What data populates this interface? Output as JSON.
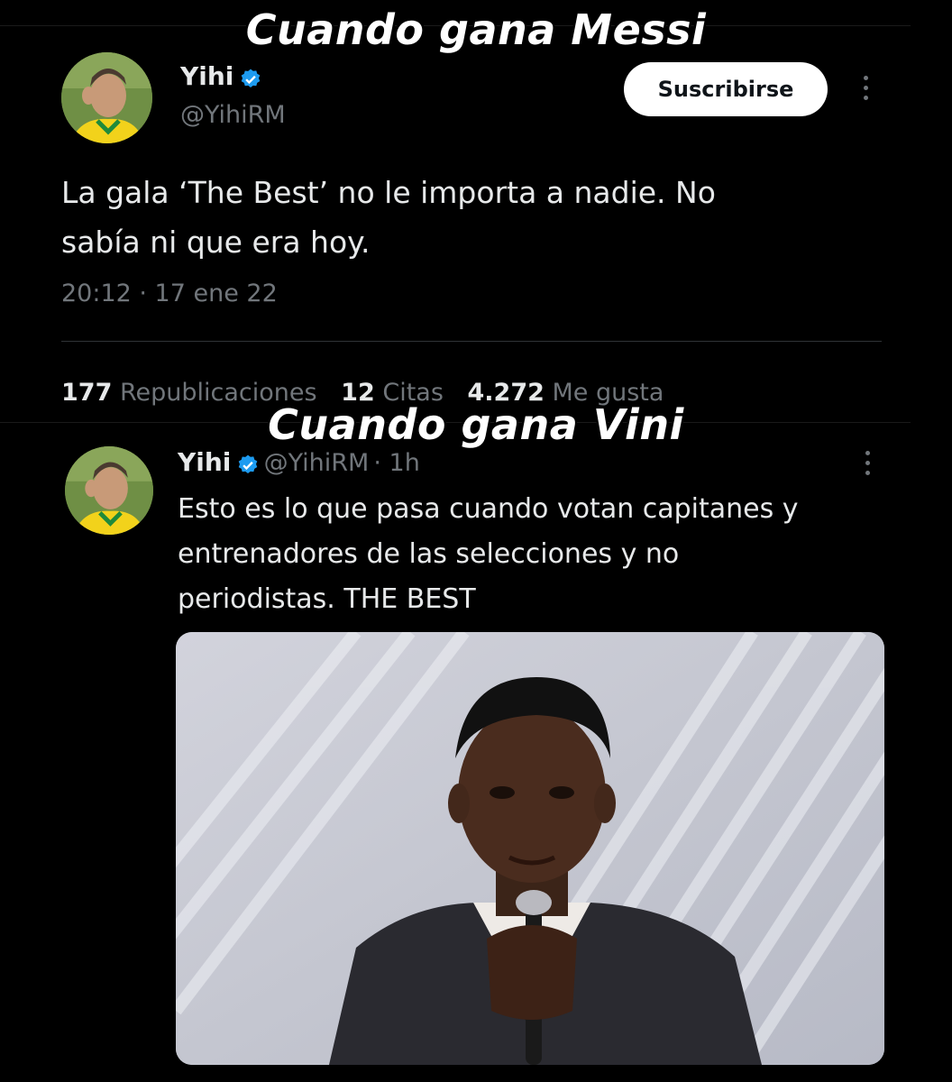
{
  "captions": {
    "top": "Cuando gana Messi",
    "middle": "Cuando gana Vini"
  },
  "tweet1": {
    "author_name": "Yihi",
    "author_handle": "@YihiRM",
    "subscribe_label": "Suscribirse",
    "text_line1": "La gala ‘The Best’ no le importa a nadie. No",
    "text_line2": "sabía ni que era hoy.",
    "timestamp": "20:12 · 17 ene 22",
    "stats": {
      "reposts_count": "177",
      "reposts_label": "Republicaciones",
      "quotes_count": "12",
      "quotes_label": "Citas",
      "likes_count": "4.272",
      "likes_label": "Me gusta"
    }
  },
  "tweet2": {
    "author_name": "Yihi",
    "author_handle": "@YihiRM",
    "time_ago": "· 1h",
    "text_line1": "Esto es lo que pasa cuando votan capitanes y",
    "text_line2": "entrenadores de las selecciones y no",
    "text_line3": "periodistas. THE BEST"
  },
  "icons": {
    "verified": "verified-badge-icon",
    "more": "more-vertical-icon"
  },
  "colors": {
    "background": "#000000",
    "text": "#e7e9ea",
    "muted": "#71767b",
    "verified": "#1d9bf0",
    "divider": "#2f3336"
  }
}
